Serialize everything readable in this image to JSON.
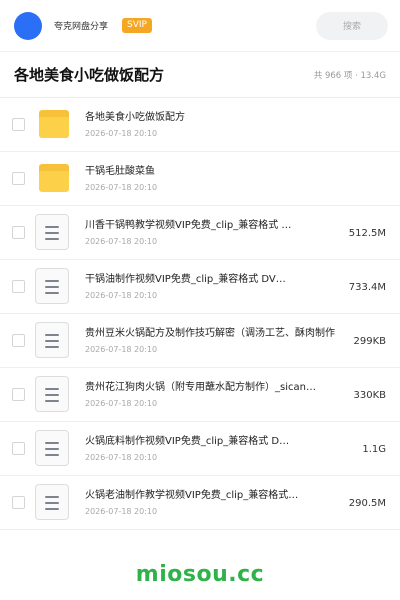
{
  "header": {
    "brand": "夸克网盘分享",
    "badge": "SVIP",
    "search_placeholder": "搜索",
    "accent_color": "#2b6ff7"
  },
  "title_bar": {
    "title": "各地美食小吃做饭配方",
    "summary": "共 966 项 · 13.4G"
  },
  "files": [
    {
      "type": "folder-icon",
      "name": "各地美食小吃做饭配方",
      "date": "2026-07-18 20:10",
      "size": ""
    },
    {
      "type": "folder-icon",
      "name": "干锅毛肚酸菜鱼",
      "date": "2026-07-18 20:10",
      "size": ""
    },
    {
      "type": "document-icon",
      "name": "川香干锅鸭教学视频VIP免费_clip_兼容格式 …",
      "date": "2026-07-18 20:10",
      "size": "512.5M"
    },
    {
      "type": "document-icon",
      "name": "干锅油制作视频VIP免费_clip_兼容格式 DV…",
      "date": "2026-07-18 20:10",
      "size": "733.4M"
    },
    {
      "type": "document-icon",
      "name": "贵州豆米火锅配方及制作技巧解密（调汤工艺、酥肉制作",
      "date": "2026-07-18 20:10",
      "size": "299KB"
    },
    {
      "type": "document-icon",
      "name": "贵州花江狗肉火锅（附专用蘸水配方制作）_sican…",
      "date": "2026-07-18 20:10",
      "size": "330KB"
    },
    {
      "type": "document-icon",
      "name": "火锅底料制作视频VIP免费_clip_兼容格式 D…",
      "date": "2026-07-18 20:10",
      "size": "1.1G"
    },
    {
      "type": "document-icon",
      "name": "火锅老油制作教学视频VIP免费_clip_兼容格式…",
      "date": "2026-07-18 20:10",
      "size": "290.5M"
    }
  ],
  "watermark": "miosou.cc",
  "colors": {
    "folder": "#fdd04a",
    "badge": "#f5a623",
    "watermark": "#2fb24a"
  }
}
